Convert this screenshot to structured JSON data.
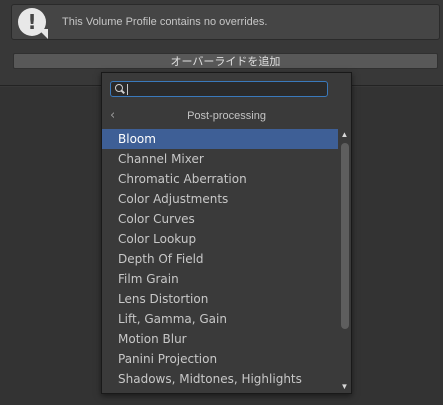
{
  "helpbox": {
    "message": "This Volume Profile contains no overrides."
  },
  "add_override": {
    "label": "オーバーライドを追加"
  },
  "popup": {
    "search": {
      "value": "",
      "placeholder": ""
    },
    "header_title": "Post-processing",
    "back_glyph": "‹",
    "items": [
      "Bloom",
      "Channel Mixer",
      "Chromatic Aberration",
      "Color Adjustments",
      "Color Curves",
      "Color Lookup",
      "Depth Of Field",
      "Film Grain",
      "Lens Distortion",
      "Lift, Gamma, Gain",
      "Motion Blur",
      "Panini Projection",
      "Shadows, Midtones, Highlights"
    ],
    "selected_index": 0
  },
  "colors": {
    "selection": "#3e5f96",
    "focus_border": "#3a79bb",
    "panel_bg": "#383838"
  }
}
